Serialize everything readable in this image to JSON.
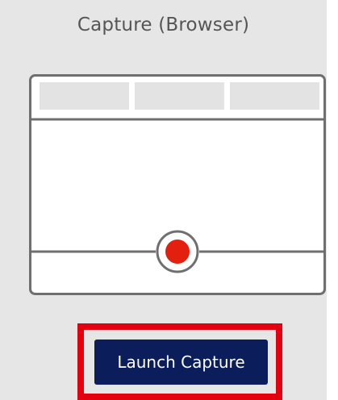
{
  "panel": {
    "title": "Capture (Browser)"
  },
  "illustration": {
    "icon": "browser-record-icon",
    "tab_count": 3,
    "record_color": "#e3200f"
  },
  "launch_button": {
    "label": "Launch Capture",
    "bg_color": "#0b1e5b",
    "highlight_color": "#e3000f"
  }
}
